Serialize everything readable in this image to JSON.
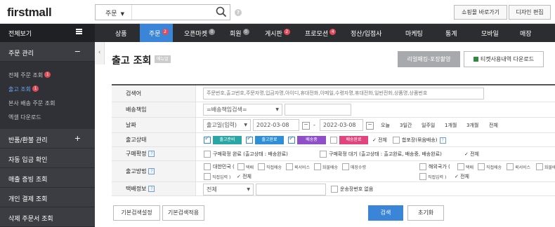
{
  "header": {
    "logo": "firstmall",
    "search_select": "주문",
    "help": "?",
    "btn_shop": "쇼핑몰 바로가기",
    "btn_design": "디자인 편집"
  },
  "gnb": {
    "all_menu": "전체보기",
    "items": [
      {
        "label": "상품"
      },
      {
        "label": "주문",
        "badge": "2"
      },
      {
        "label": "오픈마켓",
        "badge": "0"
      },
      {
        "label": "회원",
        "badge": "0"
      },
      {
        "label": "게시판",
        "badge": "2"
      },
      {
        "label": "프로모션",
        "badge": "4"
      },
      {
        "label": "정산/입점사"
      },
      {
        "label": "마케팅"
      },
      {
        "label": "통계"
      },
      {
        "label": "모바일"
      },
      {
        "label": "매장"
      }
    ]
  },
  "sidebar": {
    "order_mgmt": "주문 관리",
    "minus": "−",
    "sub": [
      {
        "label": "전체 주문 조회",
        "badge": "1"
      },
      {
        "label": "출고 조회",
        "badge": "1"
      },
      {
        "label": "본사 배송 주문 조회"
      },
      {
        "label": "엑셀 다운로드"
      }
    ],
    "cats": [
      {
        "label": "반품/환불 관리",
        "pm": "+"
      },
      {
        "label": "자동 입금 확인"
      },
      {
        "label": "매출 증빙 조회"
      },
      {
        "label": "개인 결제 조회"
      },
      {
        "label": "삭제 주문서 조회"
      }
    ]
  },
  "page": {
    "collapse": "‹",
    "title": "출고 조회",
    "manual": "매뉴얼",
    "btn_release": "리얼패킹-포장촬영",
    "btn_ticket": "티켓사용내역 다운로드"
  },
  "form": {
    "labels": {
      "keyword": "검색어",
      "shipping_group": "배송책임",
      "date": "날짜",
      "release_status": "출고상태",
      "purchase_confirm": "구매확정",
      "release_method": "출고방법",
      "courier_info": "택배정보"
    },
    "keyword_placeholder": "주문번호,출고번호,주문자명,입금자명,아이디,휴대전화,이메일,수령자명,휴대전화,일반전화,상품명,상품번호",
    "shipping_select": "=배송책임검색=",
    "date_type": "출고일(입력)",
    "date_from": "2022-03-08",
    "date_to": "2022-03-08",
    "date_sep": "-",
    "periods": [
      "오늘",
      "3일간",
      "일주일",
      "1개월",
      "3개월",
      "전체"
    ],
    "status_tags": [
      {
        "label": "출고준비",
        "color": "#2aa6a6"
      },
      {
        "label": "출고완료",
        "color": "#2f8fd6"
      },
      {
        "label": "배송중",
        "color": "#8e4fc9"
      },
      {
        "label": "배송완료",
        "color": "#e0457b"
      }
    ],
    "status_all": "전체",
    "status_combined": "합포장(묶음배송)",
    "purchase_opt1": "구매확정 완료 (출고상태 : 배송완료)",
    "purchase_opt2": "구매확정 대기 (출고상태 : 출고완료, 배송중, 배송완료)",
    "purchase_all": "전체",
    "domestic": "대한민국 (",
    "domestic_opts": [
      "택배",
      "직접배송",
      "퀵서비스",
      "화물배송",
      "매장수령"
    ],
    "domestic_direct": "직접입력 )",
    "domestic_all": "전체",
    "overseas": "해외국가 (",
    "overseas_opts": [
      "택배",
      "직접배송",
      "퀵서비스",
      "화물배송"
    ],
    "overseas_direct": "직접입력 )",
    "overseas_all": "전체",
    "courier_select": "전체",
    "no_invoice": "운송장번호 없음",
    "btn_default_set": "기본검색설정",
    "btn_default_apply": "기본검색적용",
    "btn_search": "검색",
    "btn_reset": "초기화"
  }
}
